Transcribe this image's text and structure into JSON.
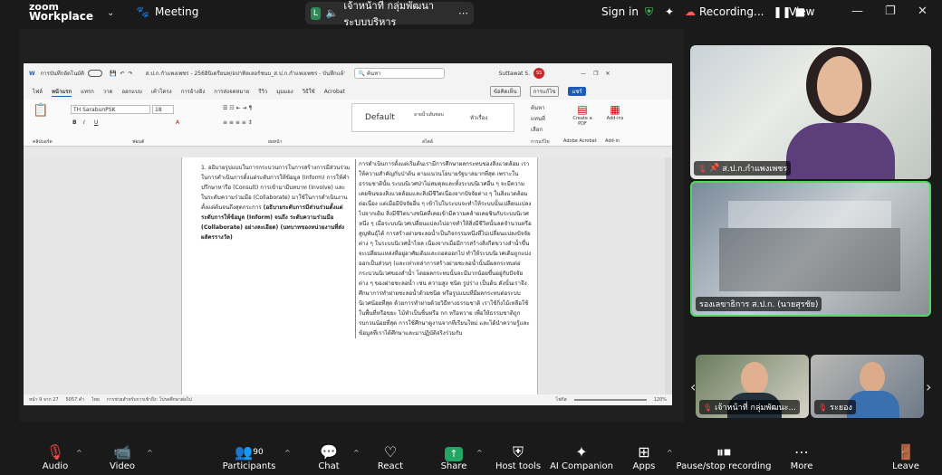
{
  "topbar": {
    "logo_top": "zoom",
    "logo_bottom": "Workplace",
    "meeting_label": "Meeting",
    "meeting_icon": "paw-icon",
    "host_tag": "L",
    "host_name": "เจ้าหน้าที่ กลุ่มพัฒนาระบบบริหาร",
    "signin": "Sign in",
    "recording": "Recording...",
    "view": "View"
  },
  "word": {
    "autosave": "การบันทึกอัตโนมัติ",
    "filename": "ส.ป.ก.กำแพงเพชร - 256อินิเตรียนท/อปาทิลเลอร์ชนบ_ส.ป.ก.กำแพงเพชร - บันทึกแล้ว",
    "search_placeholder": "ค้นหา",
    "user": "Suttawat S.",
    "user_initials": "SS",
    "menu": [
      "ไฟล์",
      "หน้าแรก",
      "แทรก",
      "วาด",
      "ออกแบบ",
      "เค้าโครง",
      "การอ้างอิง",
      "การส่งจดหมาย",
      "รีวิว",
      "มุมมอง",
      "วิธีใช้",
      "Acrobat"
    ],
    "comment_btn": "ข้อคิดเห็น",
    "edit_btn": "การแก้ไข",
    "share_btn": "แชร์",
    "font_name": "TH SarabunPSK",
    "font_size": "18",
    "style_default": "Default",
    "style_2": "ลายน้ำเส้นชอบ",
    "style_3": "หัวเรื่อง",
    "find": "ค้นหา",
    "replace": "แทนที่",
    "select": "เลือก",
    "pdf_btn": "Create a PDF",
    "addins": "Add-ins",
    "group_labels": [
      "คลิปบอร์ด",
      "ฟอนต์",
      "ย่อหน้า",
      "สไตล์",
      "การแก้ไข",
      "Adobe Acrobat",
      "Add-in"
    ],
    "col1_text": "1. อธิบายรูปแบบในการกระบวนการในการสร้างการมีส่วนร่วมในการดำเนินการตั้งแต่ระดับการให้ข้อมูล (Inform) การให้คำปรึกษาหารือ (Consult) การเข้ามามีบทบาท (Involve) และในระดับความร่วมมือ (Collaborate) มาใช้ในการดำเนินงานตั้งแต่ต้นจนถึงสุดกระการ",
    "col1_bold": "(อธิบายระดับการมีส่วนร่วมตั้งแต่ ระดับการให้ข้อมูล (Inform) จนถึง ระดับความร่วมมือ (Collaborate) อย่างละเอียด) (นทบาทของหน่วยงานที่ส่งผลัครรางวัล)",
    "col2_text": "การดำเนินการตั้งแต่เริ่มต้นเรามีการศึกษาผลกระทบของสิ่งแวดล้อม เราให้ความสำคัญกับป่าต้น ตามแนวนโยบายรัฐบาลมากที่สุด เพราะในธรรมชาตินั้น ระบบนิเวศป่าไม่สมดุลและทั้งระบบนิเวศอื่น ๆ จะมีความเคยชินของสิ่งแวดล้อมและสิ่งมีชีวิตเนื่องจากปัจจัยต่าง ๆ ในสิ่งแวดล้อมต่อเนื่อง แต่เมื่อมีปัจจัยอื่น ๆ เข้าไปในระบบจะทำให้ระบบนั้นเปลี่ยนแปลงไปจากเดิม สิ่งมีชีวิตบางชนิดที่เคยเข้ามีความคล้ายเคยชินกับระบบนิเวศหนึ่ง ๆ เมื่อระบบนิเวศเปลี่ยนแปลงไปอาจทำให้สิ่งมีชีวิตนั้นลดจำนวนหรือสูญพันธุ์ได้ การสร้างฝายชะลอน้ำเป็นกิจกรรมหนึ่งที่ไปเปลี่ยนแปลงปัจจัยต่าง ๆ ในระบบนิเวศน้ำไหล เนื่องจากเมื่อมีการสร้างสิ่งกีดขวางลำน้ำขึ้นจะเปลี่ยนแหล่งที่อยู่อาศัยเดิมและถอดออกไป ทำให้ระบบนิเวศเดิมถูกแบ่งออกเป็นส่วนๆ (และเท่าเหล่าการสร้างฝายชะลอน้ำนั้นมีผลกระทบต่อกระบวนนิเวศของลำน้ำ โดยผลกระทบนั้นจะมีมากน้อยขึ้นอยู่กับปัจจัยต่าง ๆ ของฝายชะลอน้ำ เช่น ความสูง ชนิด รูปร่าง เป็นต้น ดังนั้นเราจึงศึกษาการทำฝายชะลอน้ำด้วยชนิด หรือรูปแบบที่มีผลกระทบต่อระบบนิเวศน้อยที่สุด ด้วยการทำฝายด้วยวิธีทางธรรมชาติ เราใช้กิ่งไม้เหลือใช้ในพื้นที่หรือขยะ ไม้ทำเป็นชิ้นหรือ กก หรือหวาย เพื่อให้ธรรมชาติถูกรบกวนน้อยที่สุด การใช้ศึกษาดูงานจากที่เรียนใหม่ และได้นำความรู้และข้อมูลที่เราได้ศึกษาและมาปฏิบัติจริงร่วมกับ",
    "status_page": "หน้า 9 จาก 27",
    "status_words": "5057 คำ",
    "status_lang": "ไทย",
    "status_access": "การช่วยสำหรับการเข้าถึง: โปรดศึกษาต่อไป",
    "status_focus": "โฟกัส",
    "zoom": "120%"
  },
  "tiles": [
    {
      "label": "ส.ป.ก.กำแพงเพชร",
      "muted": true,
      "pinned": true
    },
    {
      "label": "รองเลขาธิการ ส.ป.ก. (นายสุรชัย)",
      "muted": false,
      "pinned": false
    },
    {
      "label": "เจ้าหน้าที่ กลุ่มพัฒนะ...",
      "muted": true,
      "pinned": false
    },
    {
      "label": "ระยอง",
      "muted": true,
      "pinned": false
    }
  ],
  "toolbar": {
    "audio": "Audio",
    "video": "Video",
    "participants": "Participants",
    "participants_count": "90",
    "chat": "Chat",
    "react": "React",
    "share": "Share",
    "host_tools": "Host tools",
    "ai": "AI Companion",
    "apps": "Apps",
    "pause": "Pause/stop recording",
    "more": "More",
    "leave": "Leave"
  },
  "colors": {
    "active_speaker": "#4cd964",
    "share_green": "#21a663",
    "leave_red": "#ff4d4d"
  }
}
